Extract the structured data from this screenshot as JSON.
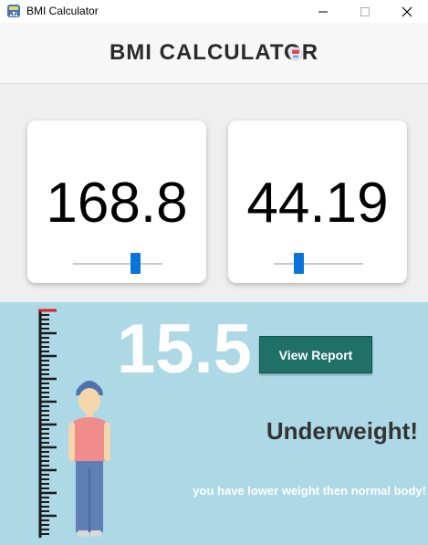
{
  "window": {
    "title": "BMI Calculator"
  },
  "header": {
    "title": "BMI CALCULATOR"
  },
  "height_card": {
    "value": "168.8",
    "slider_level": 0.72
  },
  "weight_card": {
    "value": "44.19",
    "slider_level": 0.25
  },
  "result": {
    "bmi": "15.5",
    "report_button": "View Report",
    "category": "Underweight!",
    "message": "you have lower weight then normal body!"
  },
  "colors": {
    "header_bg": "#f7f7f7",
    "inputs_bg": "#efefef",
    "results_bg": "#add8e6",
    "slider_thumb": "#0a74da",
    "report_button_bg": "#1f7066",
    "category_text": "#333333"
  },
  "icons": {
    "app": "calculator-app-icon",
    "minimize": "minimize-icon",
    "maximize": "maximize-icon",
    "close": "close-icon",
    "header_logo": "calculator-logo-icon"
  }
}
